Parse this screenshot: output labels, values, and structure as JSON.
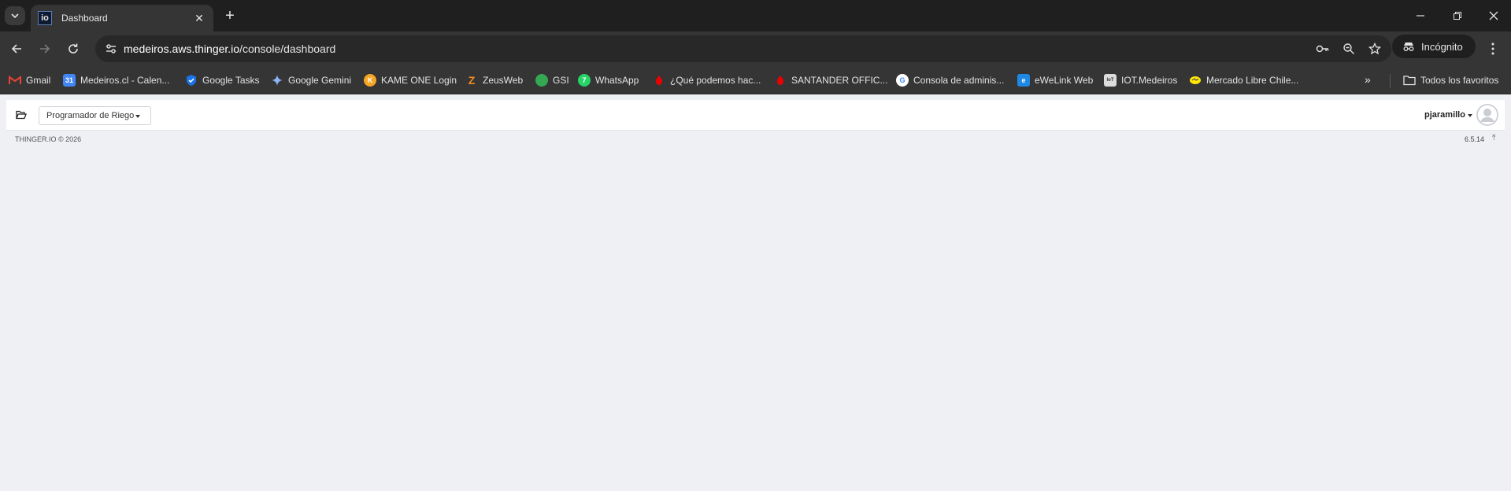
{
  "browser": {
    "tab": {
      "favicon": "io",
      "title": "Dashboard"
    },
    "url": {
      "host": "medeiros.aws.thinger.io",
      "path": "/console/dashboard"
    },
    "incognito_label": "Incógnito",
    "bookmarks": [
      {
        "label": "Gmail",
        "icon": "gmail-icon",
        "color": "#ea4335"
      },
      {
        "label": "Medeiros.cl - Calen...",
        "icon": "calendar-icon",
        "color": "#4285f4"
      },
      {
        "label": "Google Tasks",
        "icon": "tasks-icon",
        "color": "#1a73e8"
      },
      {
        "label": "Google Gemini",
        "icon": "gemini-icon",
        "color": "#8ab4f8"
      },
      {
        "label": "KAME ONE Login",
        "icon": "kame-icon",
        "color": "#f5a623"
      },
      {
        "label": "ZeusWeb",
        "icon": "zeus-icon",
        "color": "#f28b22"
      },
      {
        "label": "GSI",
        "icon": "gsi-icon",
        "color": "#34a853"
      },
      {
        "label": "WhatsApp",
        "icon": "whatsapp-icon",
        "color": "#25d366"
      },
      {
        "label": "¿Qué podemos hac...",
        "icon": "santander-icon",
        "color": "#ec0000"
      },
      {
        "label": "SANTANDER OFFIC...",
        "icon": "santander-icon",
        "color": "#ec0000"
      },
      {
        "label": "Consola de adminis...",
        "icon": "google-icon",
        "color": "#ffffff"
      },
      {
        "label": "eWeLink Web",
        "icon": "ewelink-icon",
        "color": "#1e88e5"
      },
      {
        "label": "IOT.Medeiros",
        "icon": "iot-icon",
        "color": "#dddddd"
      },
      {
        "label": "Mercado Libre Chile...",
        "icon": "mercadolibre-icon",
        "color": "#ffe600"
      }
    ],
    "favorites_folder": "Todos los favoritos"
  },
  "app": {
    "dashboard_select": "Programador de Riego",
    "user": "pjaramillo",
    "copyright": "THINGER.IO © 2026",
    "version": "6.5.14"
  }
}
